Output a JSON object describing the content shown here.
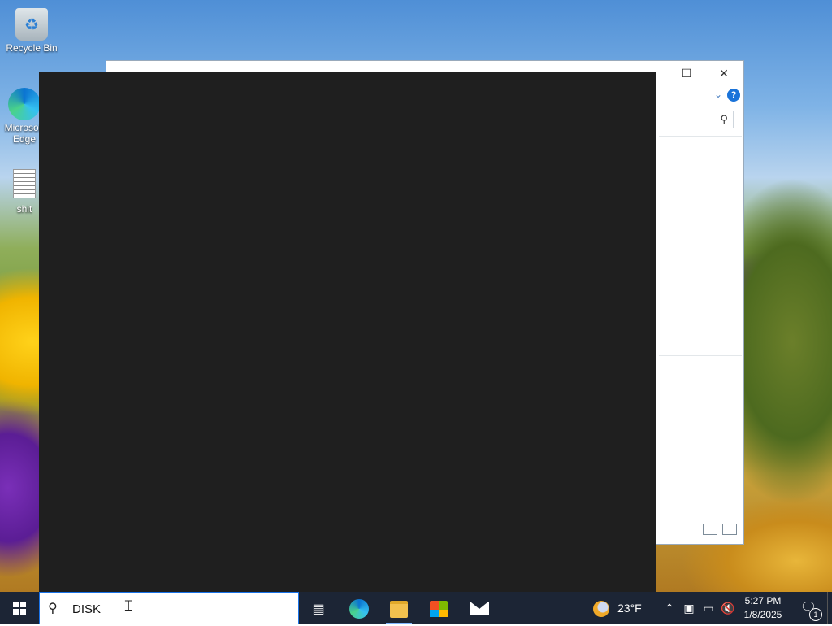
{
  "desktop": {
    "icons": [
      {
        "label": "Recycle Bin"
      },
      {
        "label": "Microsoft Edge"
      },
      {
        "label": "shit"
      }
    ]
  },
  "explorer": {
    "maximize_glyph": "☐",
    "close_glyph": "✕",
    "help_glyph": "?",
    "chevron_glyph": "⌄"
  },
  "taskbar": {
    "search_value": "DISK",
    "weather": {
      "temp": "23°F",
      "icon": "moon-cloud-icon"
    },
    "clock": {
      "time": "5:27 PM",
      "date": "1/8/2025"
    },
    "notification_count": "1",
    "apps": [
      {
        "name": "task-view",
        "icon": "task-view-icon"
      },
      {
        "name": "edge",
        "icon": "edge-icon"
      },
      {
        "name": "file-explorer",
        "icon": "folder-icon",
        "active": true
      },
      {
        "name": "store",
        "icon": "store-icon"
      },
      {
        "name": "mail",
        "icon": "mail-icon"
      }
    ],
    "tray_icons": [
      "chevron-up-icon",
      "meet-now-icon",
      "network-icon",
      "volume-muted-icon"
    ]
  }
}
